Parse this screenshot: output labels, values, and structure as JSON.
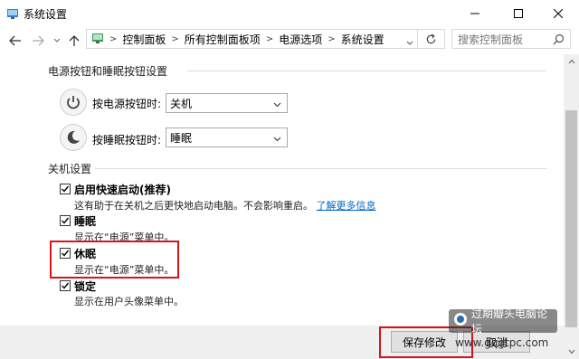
{
  "window": {
    "title": "系统设置"
  },
  "nav": {
    "breadcrumbs": [
      "控制面板",
      "所有控制面板项",
      "电源选项",
      "系统设置"
    ],
    "search_placeholder": "搜索控制面板"
  },
  "power_section": {
    "title": "电源按钮和睡眠按钮设置",
    "power_button_label": "按电源按钮时:",
    "power_button_value": "关机",
    "sleep_button_label": "按睡眠按钮时:",
    "sleep_button_value": "睡眠"
  },
  "shutdown_section": {
    "title": "关机设置",
    "items": [
      {
        "label": "启用快速启动(推荐)",
        "desc": "这有助于在关机之后更快地启动电脑。不会影响重启。",
        "link": "了解更多信息",
        "checked": true
      },
      {
        "label": "睡眠",
        "desc": "显示在“电源”菜单中。",
        "checked": true
      },
      {
        "label": "休眠",
        "desc": "显示在“电源”菜单中。",
        "checked": true
      },
      {
        "label": "锁定",
        "desc": "显示在用户头像菜单中。",
        "checked": true
      }
    ]
  },
  "footer": {
    "save_label": "保存修改",
    "cancel_label": "取消"
  },
  "watermark": {
    "text": "过期瓣头电脑论坛",
    "url": "www.gqgtpc.com"
  },
  "colors": {
    "highlight": "#d8141a",
    "link": "#0066cc"
  }
}
